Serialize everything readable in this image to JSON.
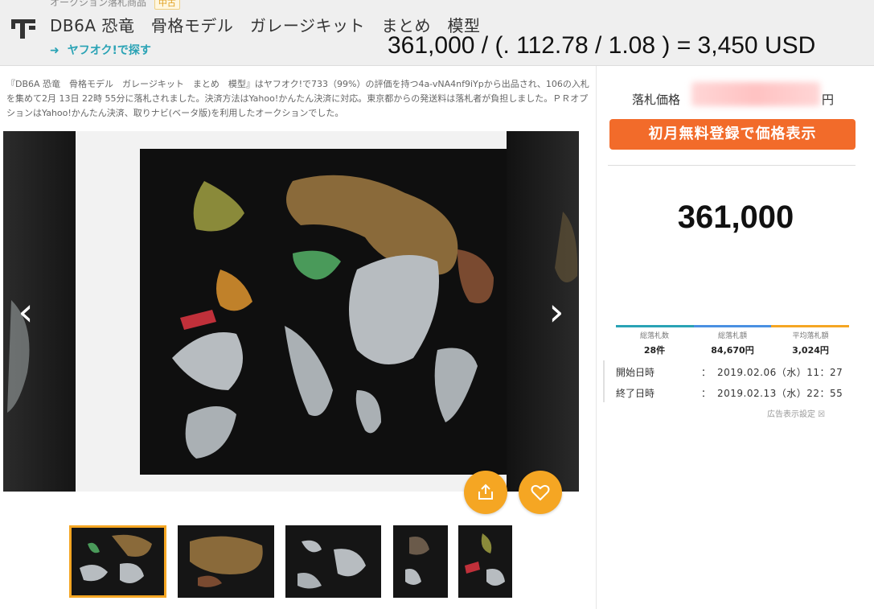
{
  "header": {
    "breadcrumb": "オークション落札商品",
    "badge": "中古",
    "title": "DB6A 恐竜　骨格モデル　ガレージキット　まとめ　模型",
    "search_link": "ヤフオク!で探す",
    "formula": "361,000 / (. 112.78 / 1.08 ) = 3,450 USD"
  },
  "description": "『DB6A 恐竜　骨格モデル　ガレージキット　まとめ　模型』はヤフオク!で733（99%）の評価を持つ4a-vNA4nf9iYpから出品され、106の入札を集めて2月 13日 22時 55分に落札されました。決済方法はYahoo!かんたん決済に対応。東京都からの発送料は落札者が負担しました。ＰＲオプションはYahoo!かんたん決済、取りナビ(ベータ版)を利用したオークションでした。",
  "gallery": {
    "prev_icon": "‹",
    "next_icon": "›",
    "share_icon": "share-icon",
    "like_icon": "heart-icon"
  },
  "price_panel": {
    "price_label": "落札価格",
    "yen": "円",
    "register_button": "初月無料登録で価格表示",
    "big_price": "361,000"
  },
  "stats": [
    {
      "label": "総落札数",
      "value": "28件"
    },
    {
      "label": "総落札額",
      "value": "84,670円"
    },
    {
      "label": "平均落札額",
      "value": "3,024円"
    }
  ],
  "dates": [
    {
      "label": "開始日時",
      "value": "2019.02.06（水）11：27"
    },
    {
      "label": "終了日時",
      "value": "2019.02.13（水）22：55"
    }
  ],
  "ad_note": "広告表示設定 ☒",
  "colors": {
    "accent": "#f5a623",
    "register": "#f26b2a",
    "link": "#2aa3b5",
    "bar_teal": "#2aa3b5",
    "bar_blue": "#4a90e2",
    "bar_orange": "#f5a623"
  }
}
